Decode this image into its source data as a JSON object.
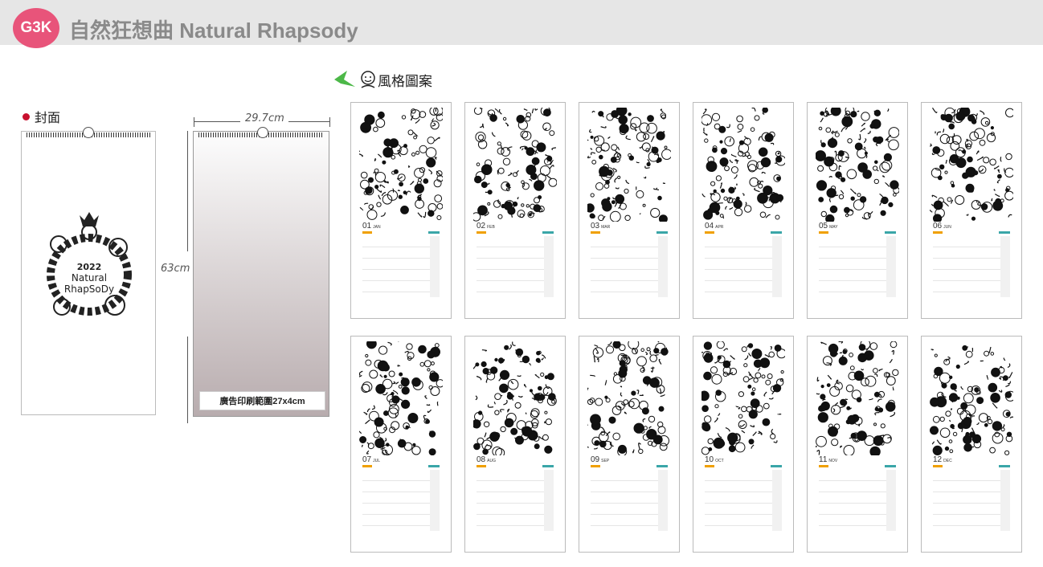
{
  "header": {
    "logo_text": "G3K",
    "title": "自然狂想曲 Natural Rhapsody"
  },
  "cover": {
    "label": "封面",
    "art_text_lines": [
      "2022",
      "Natural",
      "RhapSoDy"
    ]
  },
  "board": {
    "width_label": "29.7cm",
    "height_label": "63cm",
    "print_area_label": "廣告印刷範圍27x4cm"
  },
  "styles": {
    "label": "風格圖案"
  },
  "months": [
    {
      "num": "01",
      "abbr": "JAN"
    },
    {
      "num": "02",
      "abbr": "FEB"
    },
    {
      "num": "03",
      "abbr": "MAR"
    },
    {
      "num": "04",
      "abbr": "APR"
    },
    {
      "num": "05",
      "abbr": "MAY"
    },
    {
      "num": "06",
      "abbr": "JUN"
    },
    {
      "num": "07",
      "abbr": "JUL"
    },
    {
      "num": "08",
      "abbr": "AUG"
    },
    {
      "num": "09",
      "abbr": "SEP"
    },
    {
      "num": "10",
      "abbr": "OCT"
    },
    {
      "num": "11",
      "abbr": "NOV"
    },
    {
      "num": "12",
      "abbr": "DEC"
    }
  ],
  "colors": {
    "accent": "#e8547a",
    "header_bg": "#e6e6e6",
    "marker": "#c8102e",
    "tab_orange": "#f0a000",
    "tab_teal": "#3aa6a8"
  }
}
